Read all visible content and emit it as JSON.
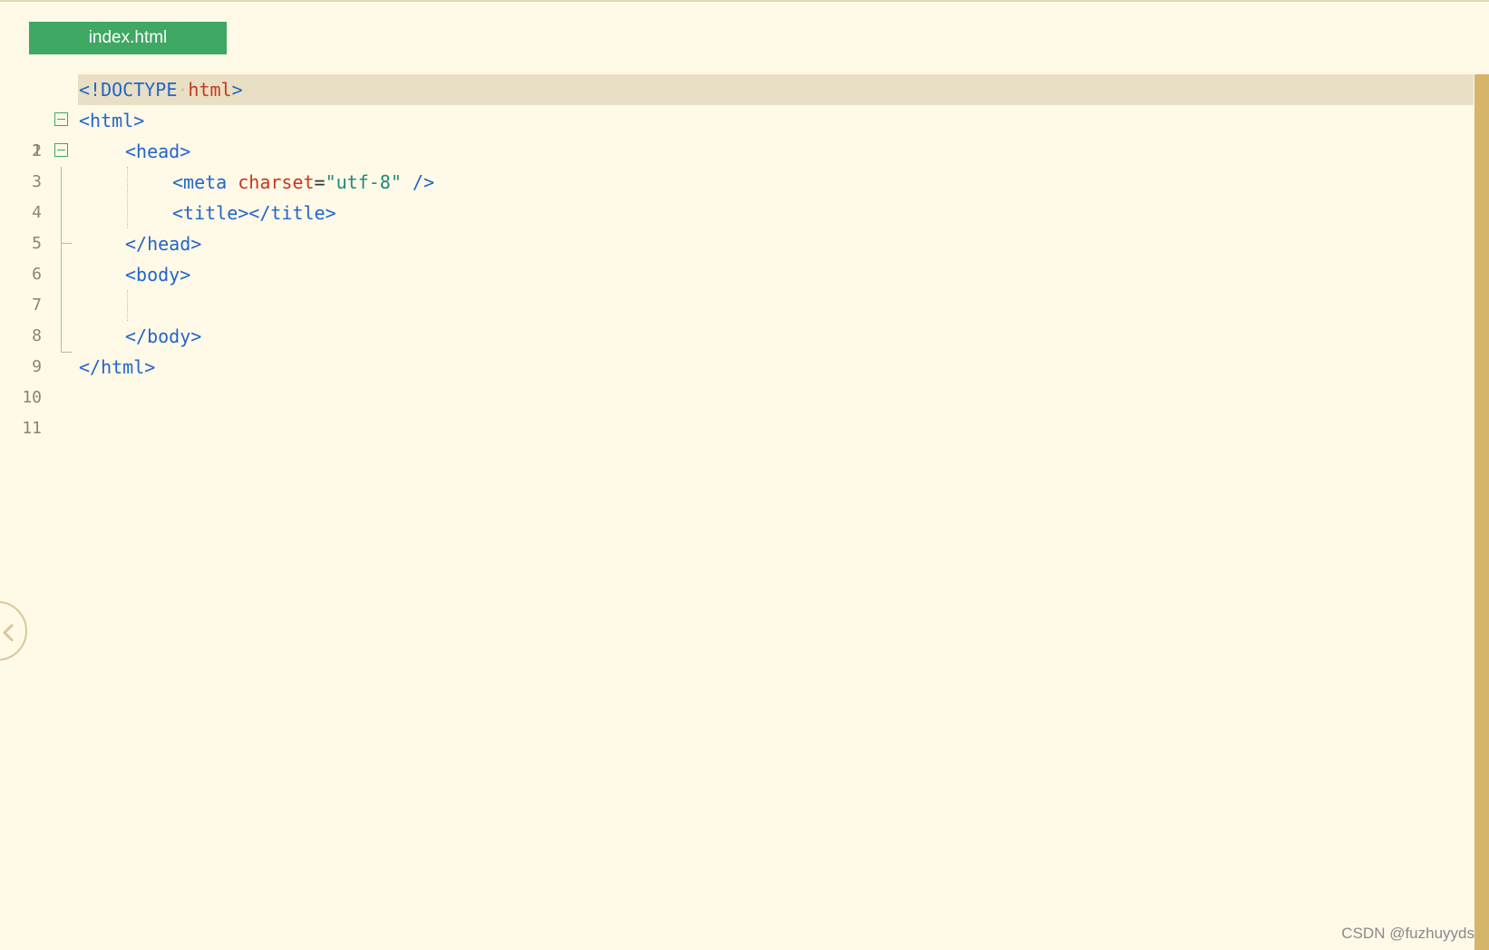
{
  "tab": {
    "label": "index.html"
  },
  "editor": {
    "lines": [
      {
        "number": "1",
        "tokens": [
          "<!DOCTYPE",
          "·",
          "html",
          ">"
        ]
      },
      {
        "number": "2",
        "tokens": [
          "<html>"
        ]
      },
      {
        "number": "3",
        "tokens": [
          "<head>"
        ]
      },
      {
        "number": "4",
        "tokens": [
          "<meta ",
          "charset",
          "=",
          "\"utf-8\"",
          " />"
        ]
      },
      {
        "number": "5",
        "tokens": [
          "<title></title>"
        ]
      },
      {
        "number": "6",
        "tokens": [
          "</head>"
        ]
      },
      {
        "number": "7",
        "tokens": [
          "<body>"
        ]
      },
      {
        "number": "8",
        "tokens": []
      },
      {
        "number": "9",
        "tokens": [
          "</body>"
        ]
      },
      {
        "number": "10",
        "tokens": [
          "</html>"
        ]
      },
      {
        "number": "11",
        "tokens": []
      }
    ]
  },
  "colors": {
    "background": "#fff9e8",
    "tab": "#3fa862",
    "tag": "#2166c8",
    "attribute": "#c8361c",
    "string": "#1e8a7a",
    "current_line": "#e9dfc4",
    "scrollbar": "#d4b56a"
  },
  "icons": {
    "fold_toggle": "minus-square-icon",
    "side_toggle": "chevron-left-icon"
  },
  "watermark": "CSDN @fuzhuyyds"
}
